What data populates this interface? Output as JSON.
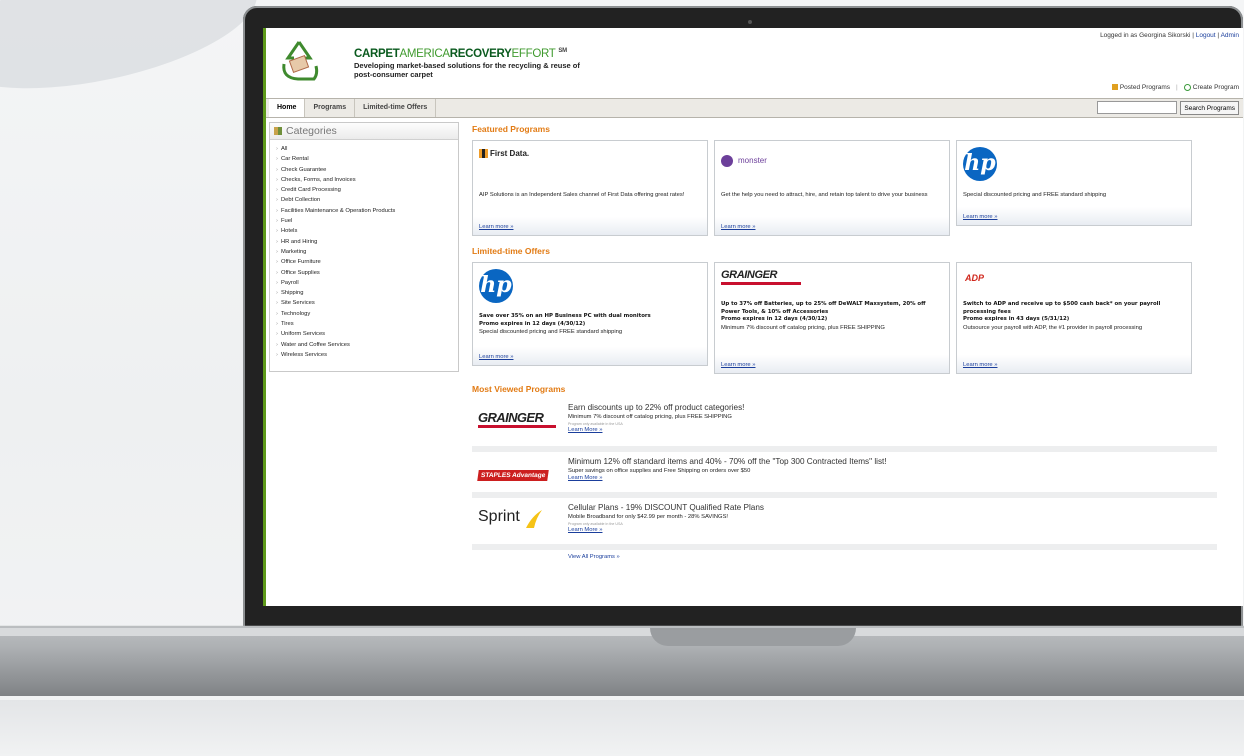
{
  "header": {
    "brand_carpet": "CARPET",
    "brand_america": "AMERICA",
    "brand_recovery": "RECOVERY",
    "brand_effort": "EFFORT",
    "brand_tm": "SM",
    "tagline": "Developing market-based solutions for the recycling & reuse of post-consumer carpet",
    "logged_in_as": "Logged in as Georgina Sikorski",
    "logout": "Logout",
    "admin": "Admin",
    "posted_programs": "Posted Programs",
    "create_program": "Create Program"
  },
  "nav": {
    "tabs": [
      {
        "label": "Home"
      },
      {
        "label": "Programs"
      },
      {
        "label": "Limited-time Offers"
      }
    ],
    "search_placeholder": "",
    "search_button": "Search Programs"
  },
  "sidebar": {
    "title": "Categories",
    "items": [
      "All",
      "Car Rental",
      "Check Guarantee",
      "Checks, Forms, and Invoices",
      "Credit Card Processing",
      "Debt Collection",
      "Facilities Maintenance & Operation Products",
      "Fuel",
      "Hotels",
      "HR and Hiring",
      "Marketing",
      "Office Furniture",
      "Office Supplies",
      "Payroll",
      "Shipping",
      "Site Services",
      "Technology",
      "Tires",
      "Uniform Services",
      "Water and Coffee Services",
      "Wireless Services"
    ]
  },
  "featured": {
    "title": "Featured Programs",
    "cards": [
      {
        "logo": "First Data.",
        "desc": "AIP Solutions is an Independent Sales channel of First Data offering great rates!",
        "link": "Learn more »"
      },
      {
        "logo": "monster",
        "desc": "Get the help you need to attract, hire, and retain top talent to drive your business",
        "link": "Learn more »"
      },
      {
        "logo": "hp",
        "desc": "Special discounted pricing and FREE standard shipping",
        "link": "Learn more »"
      }
    ]
  },
  "offers": {
    "title": "Limited-time Offers",
    "cards": [
      {
        "logo": "hp",
        "headline": "Save over 35% on an HP Business PC with dual monitors",
        "promo": "Promo expires in 12 days (4/30/12)",
        "desc": "Special discounted pricing and FREE standard shipping",
        "link": "Learn more »"
      },
      {
        "logo": "GRAINGER",
        "headline": "Up to 37% off Batteries, up to 25% off DeWALT Maxsystem, 20% off Power Tools, & 10% off Accessories",
        "promo": "Promo expires in 12 days (4/30/12)",
        "desc": "Minimum 7% discount off catalog pricing, plus FREE SHIPPING",
        "link": "Learn more »"
      },
      {
        "logo": "ADP",
        "headline": "Switch to ADP and receive up to $500 cash back* on your payroll processing fees",
        "promo": "Promo expires in 43 days (5/31/12)",
        "desc": "Outsource your payroll with ADP, the #1 provider in payroll processing",
        "link": "Learn more »"
      }
    ]
  },
  "most_viewed": {
    "title": "Most Viewed Programs",
    "items": [
      {
        "logo": "GRAINGER",
        "headline": "Earn discounts up to 22% off product categories!",
        "sub": "Minimum 7% discount off catalog pricing, plus FREE SHIPPING",
        "note": "Program only available in the USA",
        "link": "Learn More »"
      },
      {
        "logo": "STAPLES Advantage",
        "headline": "Minimum 12% off standard items and 40% - 70% off the \"Top 300 Contracted Items\" list!",
        "sub": "Super savings on office supplies and Free Shipping on orders over $50",
        "note": "",
        "link": "Learn More »"
      },
      {
        "logo": "Sprint",
        "headline": "Cellular Plans - 19% DISCOUNT Qualified Rate Plans",
        "sub": "Mobile Broadband for only $42.99 per month - 28% SAVINGS!",
        "note": "Program only available in the USA",
        "link": "Learn More »"
      }
    ],
    "view_all": "View All Programs »"
  }
}
